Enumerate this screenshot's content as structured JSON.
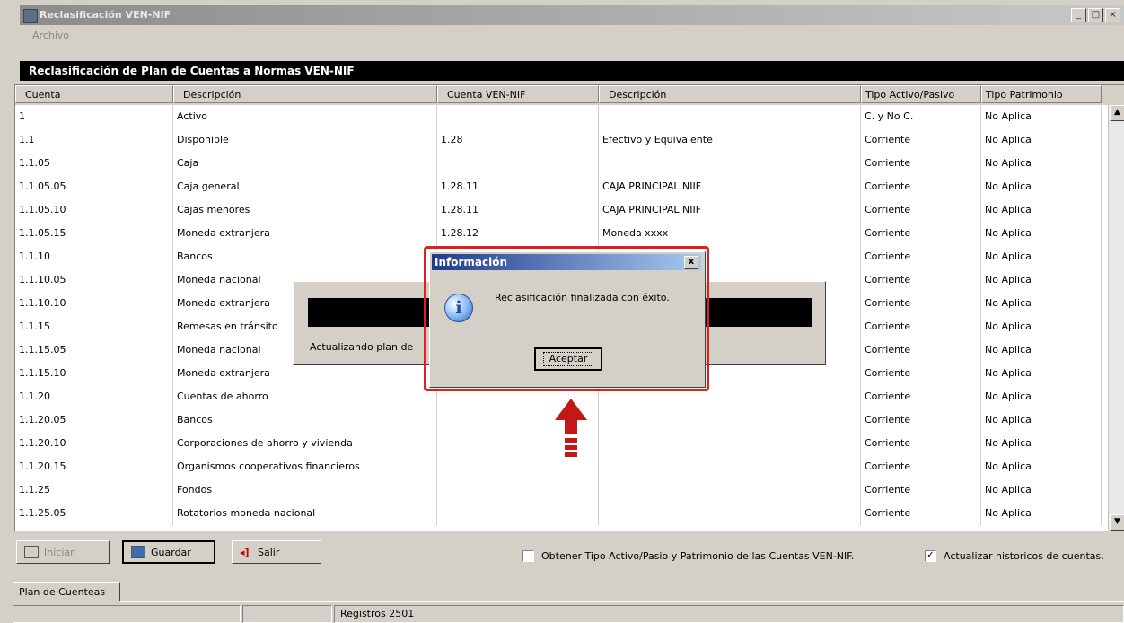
{
  "window": {
    "title": "Reclasificación VEN-NIF",
    "menu": [
      "Archivo"
    ]
  },
  "panel_title": "Reclasificación de Plan de Cuentas a Normas VEN-NIF",
  "grid": {
    "columns": [
      "Cuenta",
      "Descripción",
      "Cuenta VEN-NIF",
      "Descripción",
      "Tipo Activo/Pasivo",
      "Tipo Patrimonio"
    ],
    "rows": [
      [
        "1",
        "Activo",
        "",
        "",
        "C. y No C.",
        "No Aplica"
      ],
      [
        "1.1",
        "Disponible",
        "1.28",
        "Efectivo y Equivalente",
        "Corriente",
        "No Aplica"
      ],
      [
        "1.1.05",
        "Caja",
        "",
        "",
        "Corriente",
        "No Aplica"
      ],
      [
        "1.1.05.05",
        "Caja general",
        "1.28.11",
        "CAJA PRINCIPAL NIIF",
        "Corriente",
        "No Aplica"
      ],
      [
        "1.1.05.10",
        "Cajas menores",
        "1.28.11",
        "CAJA PRINCIPAL NIIF",
        "Corriente",
        "No Aplica"
      ],
      [
        "1.1.05.15",
        "Moneda extranjera",
        "1.28.12",
        "Moneda xxxx",
        "Corriente",
        "No Aplica"
      ],
      [
        "1.1.10",
        "Bancos",
        "",
        "",
        "Corriente",
        "No Aplica"
      ],
      [
        "1.1.10.05",
        "Moneda nacional",
        "",
        "",
        "Corriente",
        "No Aplica"
      ],
      [
        "1.1.10.10",
        "Moneda extranjera",
        "",
        "",
        "Corriente",
        "No Aplica"
      ],
      [
        "1.1.15",
        "Remesas en tránsito",
        "",
        "",
        "Corriente",
        "No Aplica"
      ],
      [
        "1.1.15.05",
        "Moneda nacional",
        "",
        "",
        "Corriente",
        "No Aplica"
      ],
      [
        "1.1.15.10",
        "Moneda extranjera",
        "",
        "",
        "Corriente",
        "No Aplica"
      ],
      [
        "1.1.20",
        "Cuentas de ahorro",
        "",
        "",
        "Corriente",
        "No Aplica"
      ],
      [
        "1.1.20.05",
        "Bancos",
        "",
        "",
        "Corriente",
        "No Aplica"
      ],
      [
        "1.1.20.10",
        "Corporaciones de ahorro y vivienda",
        "",
        "",
        "Corriente",
        "No Aplica"
      ],
      [
        "1.1.20.15",
        "Organismos cooperativos financieros",
        "",
        "",
        "Corriente",
        "No Aplica"
      ],
      [
        "1.1.25",
        "Fondos",
        "",
        "",
        "Corriente",
        "No Aplica"
      ],
      [
        "1.1.25.05",
        "Rotatorios moneda nacional",
        "",
        "",
        "Corriente",
        "No Aplica"
      ]
    ]
  },
  "buttons": {
    "iniciar": "Iniciar",
    "guardar": "Guardar",
    "salir": "Salir"
  },
  "checkboxes": {
    "obtener": {
      "label": "Obtener Tipo Activo/Pasio y Patrimonio de las Cuentas VEN-NIF.",
      "checked": false
    },
    "actualizar": {
      "label": "Actualizar historicos de cuentas.",
      "checked": true
    }
  },
  "tab": "Plan de Cuenteas",
  "status": {
    "registros": "Registros 2501"
  },
  "progress": {
    "text": "Actualizando plan de"
  },
  "dialog": {
    "title": "Información",
    "message": "Reclasificación finalizada con éxito.",
    "button": "Aceptar",
    "close": "x"
  }
}
